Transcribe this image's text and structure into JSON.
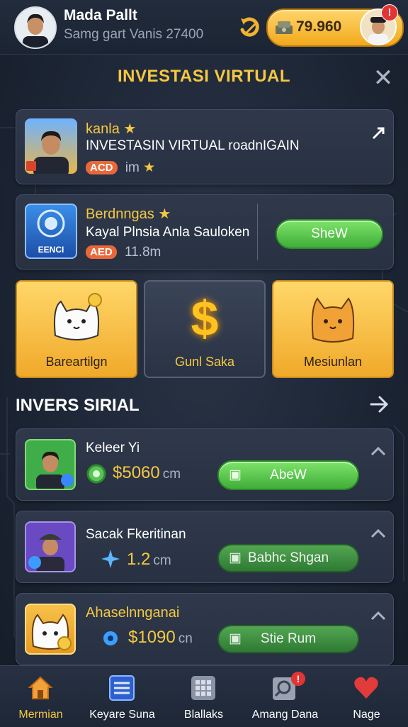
{
  "header": {
    "user_name": "Mada Pallt",
    "user_sub": "Samg gart Vanis 27400",
    "balance": "79.960",
    "notif_badge": "!"
  },
  "page": {
    "title": "INVESTASI VIRTUAL",
    "close_label": "✕"
  },
  "featured": [
    {
      "title": "kanla",
      "line": "INVESTASIN VIRTUAL roadnIGAIN",
      "tag": "ACD",
      "meta": "im"
    },
    {
      "title": "Berdnngas",
      "line": "Kayal Plnsia Anla Sauloken",
      "tag": "AED",
      "meta": "11.8m",
      "thumb_text": "EENCI",
      "button": "SheW"
    }
  ],
  "tiles": [
    {
      "label": "Bareartilgn"
    },
    {
      "label": "Gunl Saka"
    },
    {
      "label": "Mesiunlan"
    }
  ],
  "section": {
    "title": "INVERS SIRIAL"
  },
  "list": [
    {
      "name": "Keleer Yi",
      "amount": "$5060",
      "unit": "cm",
      "button": "AbeW"
    },
    {
      "name": "Sacak Fkeritinan",
      "amount": "1.2",
      "unit": "cm",
      "button": "Babhc Shgan"
    },
    {
      "name": "Ahaselnnganai",
      "amount": "$1090",
      "unit": "cn",
      "button": "Stie Rum"
    }
  ],
  "nav": [
    {
      "label": "Mermian",
      "active": true
    },
    {
      "label": "Keyare Suna"
    },
    {
      "label": "Blallaks"
    },
    {
      "label": "Amang Dana",
      "badge": "!"
    },
    {
      "label": "Nage"
    }
  ],
  "colors": {
    "accent_gold": "#f5c842",
    "button_green": "#4fc046",
    "background": "#1b2433"
  }
}
